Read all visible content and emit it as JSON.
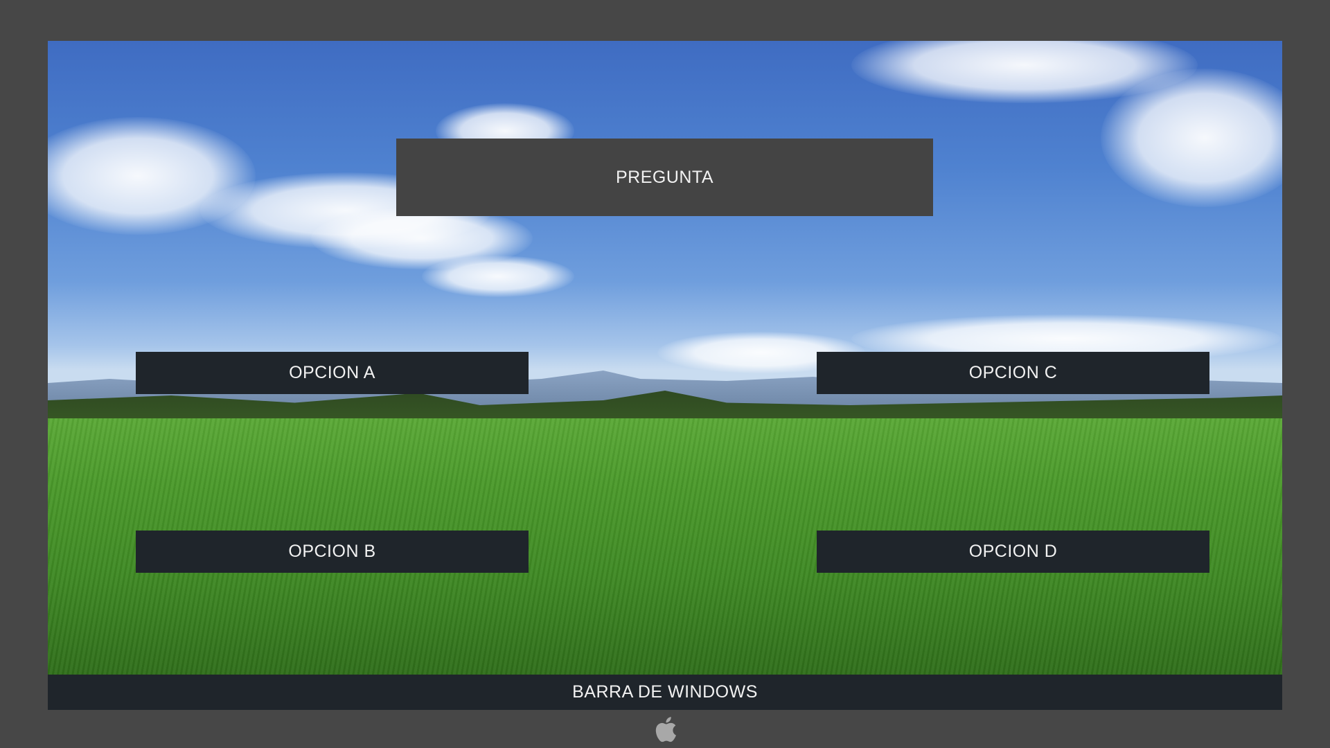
{
  "question": {
    "label": "PREGUNTA"
  },
  "options": [
    {
      "id": "A",
      "label": "OPCION A"
    },
    {
      "id": "B",
      "label": "OPCION B"
    },
    {
      "id": "C",
      "label": "OPCION C"
    },
    {
      "id": "D",
      "label": "OPCION D"
    }
  ],
  "taskbar": {
    "label": "BARRA DE WINDOWS"
  },
  "dock_icon": "apple-logo-icon",
  "colors": {
    "frame": "#474747",
    "question_bg": "#444444",
    "option_bg": "#1f252b",
    "text": "#f2f2f2"
  }
}
